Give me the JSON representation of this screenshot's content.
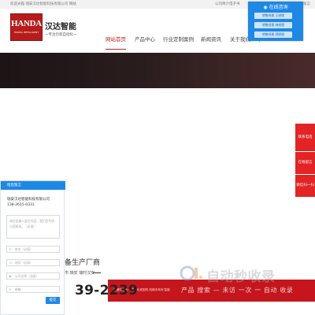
{
  "topbar": {
    "welcome": "欢迎光临 瑞安汉达智能科技有限公司 网站",
    "ebook": "公司简介电子书",
    "online": "在线留言"
  },
  "brand": {
    "logo_text": "HANDA",
    "logo_sub": "HANDA INTELLIGENT",
    "name": "汉达智能",
    "tagline": "一专注包装自动化一"
  },
  "nav": {
    "items": [
      {
        "label": "网站首页",
        "active": true
      },
      {
        "label": "产品中心",
        "active": false
      },
      {
        "label": "行业定制案例",
        "active": false
      },
      {
        "label": "新闻资讯",
        "active": false
      },
      {
        "label": "关于我们",
        "active": false
      },
      {
        "label": "产",
        "active": false
      }
    ]
  },
  "online_service": {
    "title": "在线咨询",
    "reps": [
      "销售经理-王经理",
      "销售经理-林经理",
      "销售经理-郑经理"
    ]
  },
  "contact_bar": {
    "items": [
      "联系电话",
      "在线留言",
      "微信扫一扫"
    ]
  },
  "message_form": {
    "title": "给您留言",
    "company": "瑞安汉达智能科技有限公司",
    "phone": "138-2615-0331",
    "textarea_placeholder": "请在此输入留言内容，我们会尽快与您联系。（必填）",
    "name_placeholder": "姓名（必填）",
    "tel_placeholder": "电话（必填）",
    "company_placeholder": "公司名称（选填）",
    "email_placeholder": "邮箱",
    "submit": "提交"
  },
  "main": {
    "factory_title": "备生产厂商",
    "address": "市·瑞安 瑞时汉安",
    "hotline": "39-2239"
  },
  "footer_strip": {
    "keywords": "关键词搜索：  自动化成型机  机械手系列  智能",
    "marquee": "产品 搜索 — 未访 一次 一 自动 收录"
  },
  "watermark": {
    "text": "自动秒收录"
  },
  "colors": {
    "brand_red": "#c4161c",
    "nav_active": "#c21f1f",
    "form_blue": "#1e88e5"
  }
}
